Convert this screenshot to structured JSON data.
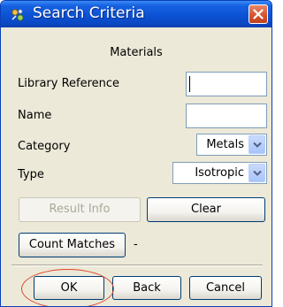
{
  "window": {
    "title": "Search Criteria",
    "close_glyph": "✕",
    "icon": "search-criteria-app-icon"
  },
  "panel": {
    "title": "Materials"
  },
  "fields": {
    "library_reference": {
      "label": "Library Reference",
      "value": ""
    },
    "name": {
      "label": "Name",
      "value": ""
    },
    "category": {
      "label": "Category",
      "value": "Metals"
    },
    "type": {
      "label": "Type",
      "value": "Isotropic"
    }
  },
  "buttons": {
    "result_info": "Result Info",
    "clear": "Clear",
    "count_matches": "Count Matches",
    "count_result": "-",
    "ok": "OK",
    "back": "Back",
    "cancel": "Cancel"
  },
  "colors": {
    "titlebar": "#0b52d4",
    "dialog_bg": "#ece9d8",
    "button_border": "#003c74",
    "highlight_ring": "#e0452a"
  }
}
